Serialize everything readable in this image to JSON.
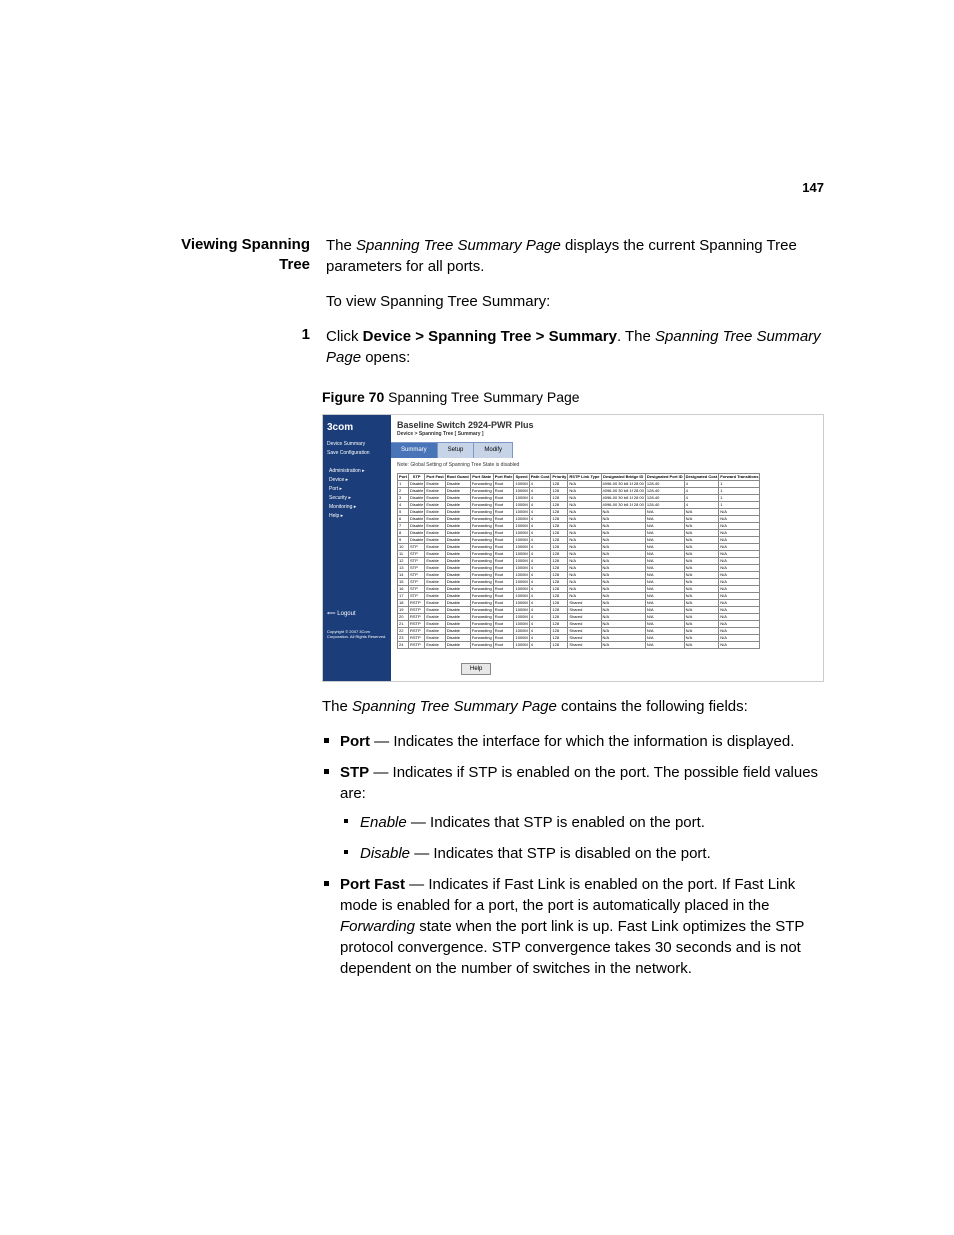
{
  "page_number": "147",
  "side_heading": "Viewing Spanning Tree",
  "intro_a": "The ",
  "intro_page": "Spanning Tree Summary Page",
  "intro_b": " displays the current Spanning Tree parameters for all ports.",
  "intro2": "To view Spanning Tree Summary:",
  "step_num": "1",
  "step_a": "Click ",
  "step_path": "Device > Spanning Tree > Summary",
  "step_b": ". The ",
  "step_page": "Spanning Tree Summary Page",
  "step_c": " opens:",
  "fig_label": "Figure 70",
  "fig_caption": "   Spanning Tree Summary Page",
  "shot": {
    "logo": "3com",
    "title": "Baseline Switch 2924-PWR Plus",
    "breadcrumb": "Device > Spanning Tree [ Summary ]",
    "tabs": [
      "Summary",
      "Setup",
      "Modify"
    ],
    "note": "Note: Global Setting of Spanning Tree State is disabled",
    "menu": [
      "Device Summary",
      "Save Configuration",
      "",
      "Administration",
      "Device",
      "Port",
      "Security",
      "Monitoring",
      "Help"
    ],
    "logout": "Logout",
    "copyright": "Copyright © 2007\n3Com Corporation.\nAll Rights Reserved.",
    "help_btn": "Help",
    "columns": [
      "Port",
      "STP",
      "Port Fast",
      "Root Guard",
      "Port State",
      "Port Role",
      "Speed",
      "Path Cost",
      "Priority",
      "RSTP Link Type",
      "Designated Bridge ID",
      "Designated Port ID",
      "Designated Cost",
      "Forward Transitions"
    ],
    "rows": [
      [
        "1",
        "Disable",
        "Enable",
        "Disable",
        "Forwarding",
        "Root",
        "1000M",
        "4",
        "128",
        "N/A",
        "4096-00 30 b8 1f 28 00",
        "128-40",
        "4",
        "1"
      ],
      [
        "2",
        "Disable",
        "Enable",
        "Disable",
        "Forwarding",
        "Root",
        "1000M",
        "4",
        "128",
        "N/A",
        "4096-00 30 b8 1f 28 00",
        "128-40",
        "4",
        "1"
      ],
      [
        "3",
        "Disable",
        "Enable",
        "Disable",
        "Forwarding",
        "Root",
        "1000M",
        "4",
        "128",
        "N/A",
        "4096-00 30 b8 1f 28 00",
        "128-40",
        "4",
        "1"
      ],
      [
        "4",
        "Disable",
        "Enable",
        "Disable",
        "Forwarding",
        "Root",
        "1000M",
        "4",
        "128",
        "N/A",
        "4096-00 30 b8 1f 28 00",
        "128-40",
        "4",
        "1"
      ],
      [
        "5",
        "Disable",
        "Enable",
        "Disable",
        "Forwarding",
        "Root",
        "1000M",
        "4",
        "128",
        "N/A",
        "N/A",
        "N/A",
        "N/A",
        "N/A"
      ],
      [
        "6",
        "Disable",
        "Enable",
        "Disable",
        "Forwarding",
        "Root",
        "1000M",
        "4",
        "128",
        "N/A",
        "N/A",
        "N/A",
        "N/A",
        "N/A"
      ],
      [
        "7",
        "Disable",
        "Enable",
        "Disable",
        "Forwarding",
        "Root",
        "1000M",
        "4",
        "128",
        "N/A",
        "N/A",
        "N/A",
        "N/A",
        "N/A"
      ],
      [
        "8",
        "Disable",
        "Enable",
        "Disable",
        "Forwarding",
        "Root",
        "1000M",
        "4",
        "128",
        "N/A",
        "N/A",
        "N/A",
        "N/A",
        "N/A"
      ],
      [
        "9",
        "Disable",
        "Enable",
        "Disable",
        "Forwarding",
        "Root",
        "1000M",
        "4",
        "128",
        "N/A",
        "N/A",
        "N/A",
        "N/A",
        "N/A"
      ],
      [
        "10",
        "STP",
        "Enable",
        "Disable",
        "Forwarding",
        "Root",
        "1000M",
        "4",
        "128",
        "N/A",
        "N/A",
        "N/A",
        "N/A",
        "N/A"
      ],
      [
        "11",
        "STP",
        "Enable",
        "Disable",
        "Forwarding",
        "Root",
        "1000M",
        "4",
        "128",
        "N/A",
        "N/A",
        "N/A",
        "N/A",
        "N/A"
      ],
      [
        "12",
        "STP",
        "Enable",
        "Disable",
        "Forwarding",
        "Root",
        "1000M",
        "4",
        "128",
        "N/A",
        "N/A",
        "N/A",
        "N/A",
        "N/A"
      ],
      [
        "13",
        "STP",
        "Enable",
        "Disable",
        "Forwarding",
        "Root",
        "1000M",
        "4",
        "128",
        "N/A",
        "N/A",
        "N/A",
        "N/A",
        "N/A"
      ],
      [
        "14",
        "STP",
        "Enable",
        "Disable",
        "Forwarding",
        "Root",
        "1000M",
        "4",
        "128",
        "N/A",
        "N/A",
        "N/A",
        "N/A",
        "N/A"
      ],
      [
        "15",
        "STP",
        "Enable",
        "Disable",
        "Forwarding",
        "Root",
        "1000M",
        "4",
        "128",
        "N/A",
        "N/A",
        "N/A",
        "N/A",
        "N/A"
      ],
      [
        "16",
        "STP",
        "Enable",
        "Disable",
        "Forwarding",
        "Root",
        "1000M",
        "4",
        "128",
        "N/A",
        "N/A",
        "N/A",
        "N/A",
        "N/A"
      ],
      [
        "17",
        "STP",
        "Enable",
        "Disable",
        "Forwarding",
        "Root",
        "1000M",
        "4",
        "128",
        "N/A",
        "N/A",
        "N/A",
        "N/A",
        "N/A"
      ],
      [
        "18",
        "RSTP",
        "Enable",
        "Disable",
        "Forwarding",
        "Root",
        "1000M",
        "4",
        "128",
        "Shared",
        "N/A",
        "N/A",
        "N/A",
        "N/A"
      ],
      [
        "19",
        "RSTP",
        "Enable",
        "Disable",
        "Forwarding",
        "Root",
        "1000M",
        "4",
        "128",
        "Shared",
        "N/A",
        "N/A",
        "N/A",
        "N/A"
      ],
      [
        "20",
        "RSTP",
        "Enable",
        "Disable",
        "Forwarding",
        "Root",
        "1000M",
        "4",
        "128",
        "Shared",
        "N/A",
        "N/A",
        "N/A",
        "N/A"
      ],
      [
        "21",
        "RSTP",
        "Enable",
        "Disable",
        "Forwarding",
        "Root",
        "1000M",
        "4",
        "128",
        "Shared",
        "N/A",
        "N/A",
        "N/A",
        "N/A"
      ],
      [
        "22",
        "RSTP",
        "Enable",
        "Disable",
        "Forwarding",
        "Root",
        "1000M",
        "4",
        "128",
        "Shared",
        "N/A",
        "N/A",
        "N/A",
        "N/A"
      ],
      [
        "23",
        "RSTP",
        "Enable",
        "Disable",
        "Forwarding",
        "Root",
        "1000M",
        "4",
        "128",
        "Shared",
        "N/A",
        "N/A",
        "N/A",
        "N/A"
      ],
      [
        "24",
        "RSTP",
        "Enable",
        "Disable",
        "Forwarding",
        "Root",
        "1000M",
        "4",
        "128",
        "Shared",
        "N/A",
        "N/A",
        "N/A",
        "N/A"
      ]
    ]
  },
  "after_fig_a": "The ",
  "after_fig_page": "Spanning Tree Summary Page",
  "after_fig_b": " contains the following fields:",
  "fields": {
    "port_label": "Port",
    "port_text": " — Indicates the interface for which the information is displayed.",
    "stp_label": "STP",
    "stp_text": " — Indicates if STP is enabled on the port. The possible field values are:",
    "stp_enable_label": "Enable",
    "stp_enable_text": " — Indicates that STP is enabled on the port.",
    "stp_disable_label": "Disable",
    "stp_disable_text": " — Indicates that STP is disabled on the port.",
    "pf_label": "Port Fast",
    "pf_text_a": " — Indicates if Fast Link is enabled on the port. If Fast Link mode is enabled for a port, the port is automatically placed in the ",
    "pf_fwd": "Forwarding",
    "pf_text_b": " state when the port link is up. Fast Link optimizes the STP protocol convergence. STP convergence takes 30 seconds and is not dependent on the number of switches in the network."
  }
}
